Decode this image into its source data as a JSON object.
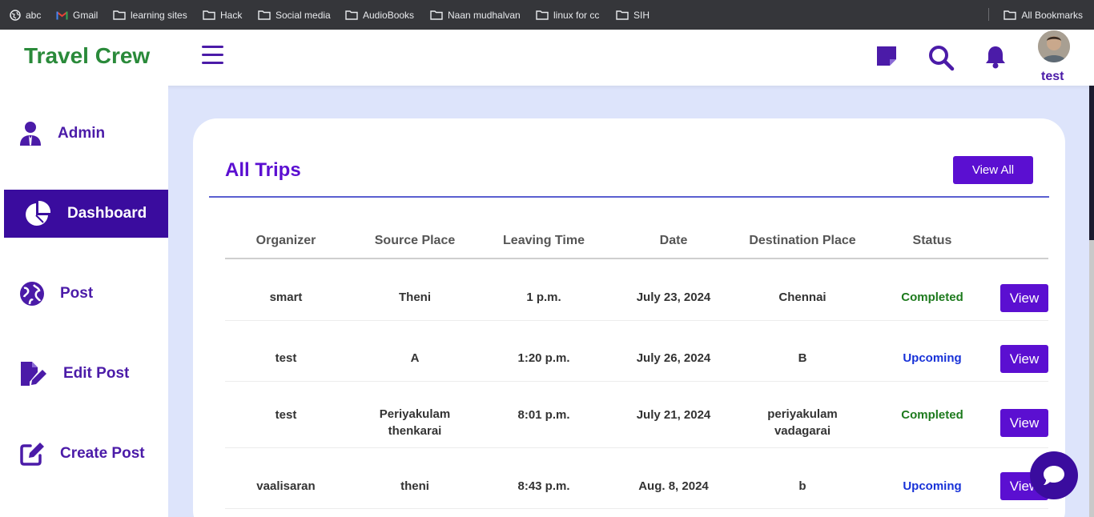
{
  "bookmarks": {
    "items": [
      "abc",
      "Gmail",
      "learning sites",
      "Hack",
      "Social media",
      "AudioBooks",
      "Naan mudhalvan",
      "linux for cc",
      "SIH"
    ],
    "all_label": "All Bookmarks"
  },
  "header": {
    "brand": "Travel Crew",
    "user_name": "test"
  },
  "sidebar": {
    "items": [
      {
        "label": "Admin",
        "icon": "user-tie-icon"
      },
      {
        "label": "Dashboard",
        "icon": "pie-chart-icon"
      },
      {
        "label": "Post",
        "icon": "globe-icon"
      },
      {
        "label": "Edit Post",
        "icon": "file-edit-icon"
      },
      {
        "label": "Create Post",
        "icon": "pen-square-icon"
      }
    ],
    "active": "Dashboard"
  },
  "card": {
    "title": "All Trips",
    "view_all_label": "View All"
  },
  "table": {
    "columns": [
      "Organizer",
      "Source Place",
      "Leaving Time",
      "Date",
      "Destination Place",
      "Status"
    ],
    "view_label": "View",
    "rows": [
      {
        "organizer": "smart",
        "source": "Theni",
        "time": "1 p.m.",
        "date": "July 23, 2024",
        "destination": "Chennai",
        "status": "Completed"
      },
      {
        "organizer": "test",
        "source": "A",
        "time": "1:20 p.m.",
        "date": "July 26, 2024",
        "destination": "B",
        "status": "Upcoming"
      },
      {
        "organizer": "test",
        "source": "Periyakulam thenkarai",
        "time": "8:01 p.m.",
        "date": "July 21, 2024",
        "destination": "periyakulam vadagarai",
        "status": "Completed"
      },
      {
        "organizer": "vaalisaran",
        "source": "theni",
        "time": "8:43 p.m.",
        "date": "Aug. 8, 2024",
        "destination": "b",
        "status": "Upcoming"
      }
    ]
  },
  "colors": {
    "brand_green": "#2a8a3a",
    "primary_purple": "#5b0fd1",
    "sidebar_active": "#3a0c9e",
    "completed_green": "#1d7a1d",
    "upcoming_blue": "#1832d8"
  }
}
